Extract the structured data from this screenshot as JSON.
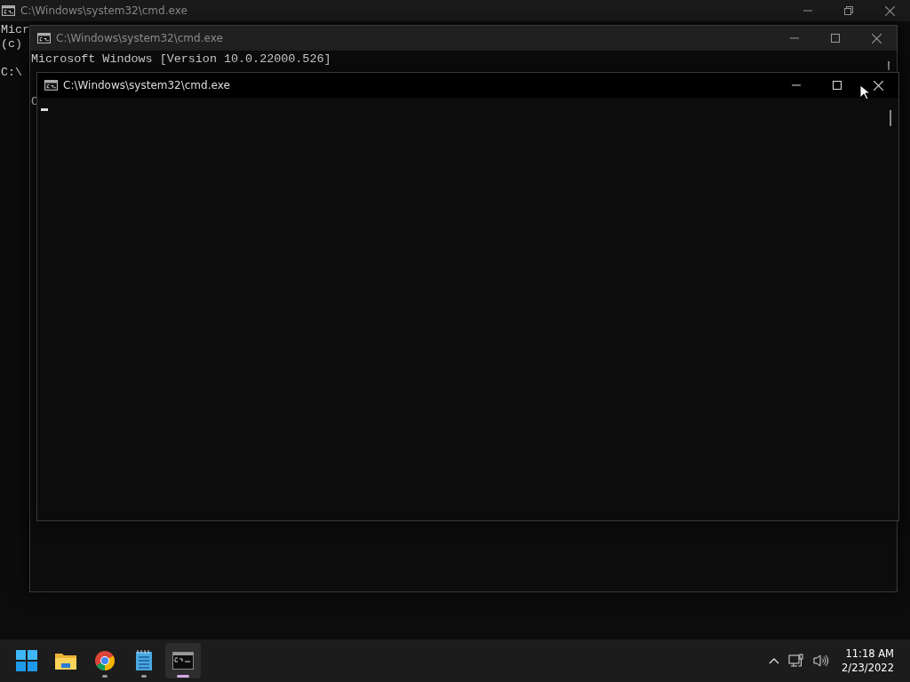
{
  "windows": [
    {
      "title": "C:\\Windows\\system32\\cmd.exe",
      "maximized": true,
      "active": false,
      "lines": [
        {
          "kind": "output",
          "text": "Micr"
        },
        {
          "kind": "output",
          "text": "(c)"
        },
        {
          "kind": "prompt",
          "text": "C:\\"
        }
      ]
    },
    {
      "title": "C:\\Windows\\system32\\cmd.exe",
      "maximized": false,
      "active": false,
      "lines": [
        {
          "kind": "output",
          "text": "Microsoft Windows [Version 10.0.22000.526]"
        },
        {
          "kind": "prompt",
          "text": "C"
        }
      ]
    },
    {
      "title": "C:\\Windows\\system32\\cmd.exe",
      "maximized": false,
      "active": true
    }
  ],
  "taskbar": {
    "apps": [
      {
        "kind": "start",
        "running": false,
        "active": false
      },
      {
        "kind": "folder",
        "running": false,
        "active": false
      },
      {
        "kind": "browser",
        "running": true,
        "active": false
      },
      {
        "kind": "notepad",
        "running": true,
        "active": false
      },
      {
        "kind": "terminal",
        "running": true,
        "active": true
      }
    ],
    "time": "11:18 AM",
    "date": "2/23/2022"
  }
}
